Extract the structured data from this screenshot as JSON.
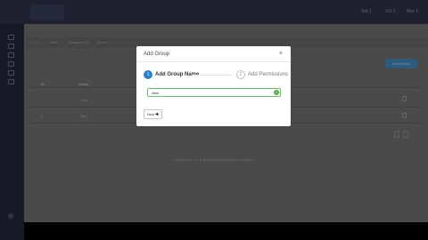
{
  "topbar": {
    "items": [
      "Set 1",
      "Oct 1",
      "Nov 1"
    ]
  },
  "breadcrumb": [
    "Home",
    "Admin",
    "Management",
    "Groups"
  ],
  "content": {
    "add_button": "Add Group",
    "table_headers": [
      "ID",
      "Group",
      ""
    ],
    "rows": [
      {
        "id": "",
        "name": "Test"
      },
      {
        "id": "1",
        "name": "Test"
      }
    ],
    "footer": "Copyright © 2019 All Rights Reserved by Company"
  },
  "modal": {
    "title": "Add Group",
    "close": "×",
    "steps": [
      {
        "number": "1",
        "label": "Add Group Name",
        "active": true
      },
      {
        "number": "2",
        "label": "Add Permissions",
        "active": false
      }
    ],
    "input_value": "New",
    "next_button": "Next"
  },
  "icons": {
    "close": "close-icon",
    "check": "check-circle-icon",
    "trash": "trash-icon"
  }
}
